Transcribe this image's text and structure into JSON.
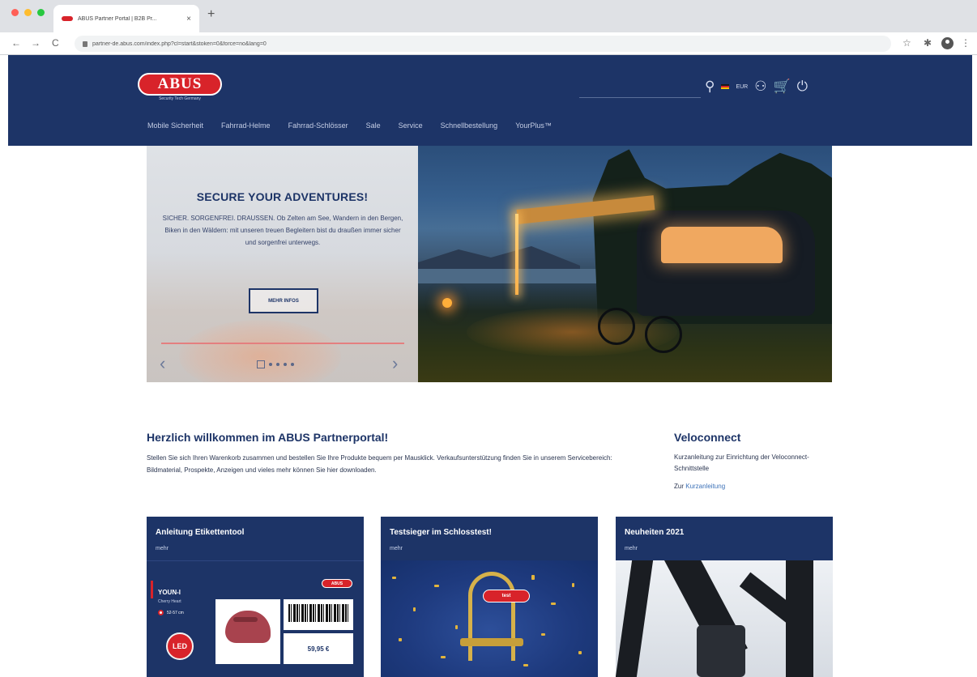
{
  "browser": {
    "tab_title": "ABUS Partner Portal | B2B Pr...",
    "tab_close": "×",
    "new_tab": "+",
    "url": "partner-de.abus.com/index.php?cl=start&stoken=0&force=no&lang=0",
    "nav": {
      "back": "←",
      "forward": "→",
      "reload": "C"
    },
    "right_icons": {
      "star": "☆",
      "extensions": "✱",
      "menu": "⋮"
    }
  },
  "header": {
    "logo_text": "ABUS",
    "logo_tagline": "Security Tech Germany",
    "currency": "EUR",
    "icons": {
      "search": "⚲",
      "account": "⚇",
      "cart": "🛒",
      "power": "⏻"
    },
    "flag_colors": [
      "#1a1a1a",
      "#d8232a",
      "#f2c200"
    ],
    "nav_items": [
      "Mobile Sicherheit",
      "Fahrrad-Helme",
      "Fahrrad-Schlösser",
      "Sale",
      "Service",
      "Schnellbestellung",
      "YourPlus™"
    ]
  },
  "hero": {
    "title": "SECURE YOUR ADVENTURES!",
    "text": "SICHER. SORGENFREI. DRAUSSEN. Ob Zelten am See, Wandern in den Bergen, Biken in den Wäldern: mit unseren treuen Begleitern bist du draußen immer sicher und sorgenfrei unterwegs.",
    "button_label": "MEHR INFOS",
    "prev": "‹",
    "next": "›",
    "slide_count": 5,
    "active_slide": 1
  },
  "welcome": {
    "title": "Herzlich willkommen im ABUS Partnerportal!",
    "text": "Stellen Sie sich Ihren Warenkorb zusammen und bestellen Sie Ihre Produkte bequem per Mausklick. Verkaufsunterstützung finden Sie in unserem Servicebereich: Bildmaterial, Prospekte, Anzeigen und vieles mehr können Sie hier downloaden."
  },
  "veloconnect": {
    "title": "Veloconnect",
    "text": "Kurzanleitung zur Einrichtung der Veloconnect-Schnittstelle",
    "link_prefix": "Zur",
    "link_label": "Kurzanleitung"
  },
  "cards": [
    {
      "title": "Anleitung Etikettentool",
      "more": "mehr",
      "product_name": "YOUN-I",
      "product_sub": "Cherry Heart",
      "product_size": "52-57 cm",
      "badge": "ABUS",
      "led": "LED",
      "price": "59,95 €"
    },
    {
      "title": "Testsieger im Schlosstest!",
      "more": "mehr",
      "badge": "test"
    },
    {
      "title": "Neuheiten 2021",
      "more": "mehr"
    }
  ],
  "colors": {
    "brand_navy": "#1d3467",
    "brand_red": "#d8232a",
    "link_blue": "#3d72b8"
  }
}
